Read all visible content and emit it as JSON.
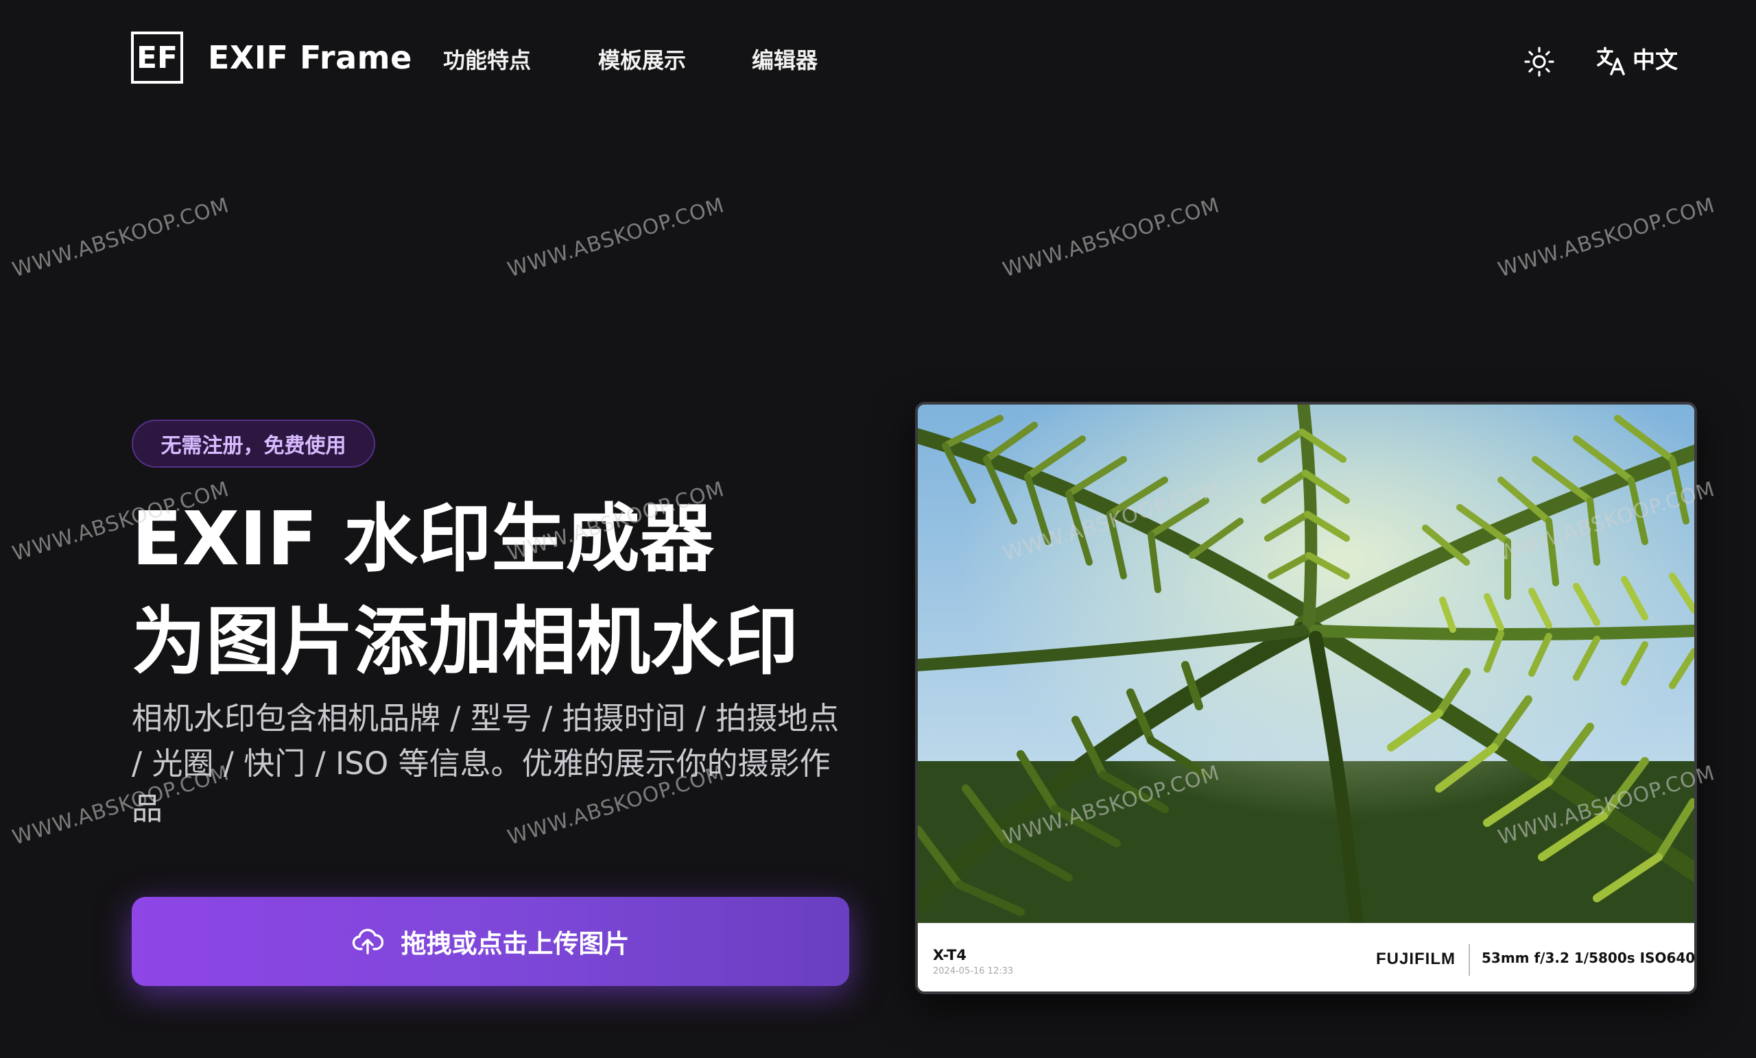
{
  "header": {
    "logo_mark": "EF",
    "logo_text": "EXIF Frame",
    "nav": [
      {
        "label": "功能特点"
      },
      {
        "label": "模板展示"
      },
      {
        "label": "编辑器"
      }
    ],
    "theme_icon": "sun-icon",
    "lang_icon": "translate-icon",
    "language": "中文"
  },
  "hero": {
    "badge": "无需注册，免费使用",
    "title_line1": "EXIF 水印生成器",
    "title_line2": "为图片添加相机水印",
    "description": "相机水印包含相机品牌 / 型号 / 拍摄时间 / 拍摄地点 / 光圈 / 快门 / ISO 等信息。优雅的展示你的摄影作品",
    "upload_icon": "cloud-upload-icon",
    "upload_label": "拖拽或点击上传图片"
  },
  "preview": {
    "camera_model": "X-T4",
    "date": "2024-05-16 12:33",
    "brand": "FUJIFILM",
    "params": "53mm f/3.2 1/5800s ISO640"
  },
  "colors": {
    "background": "#131214",
    "accent": "#8e46e6",
    "badge_text": "#d8bbff"
  },
  "watermark": {
    "text": "WWW.ABSKOOP.COM"
  }
}
